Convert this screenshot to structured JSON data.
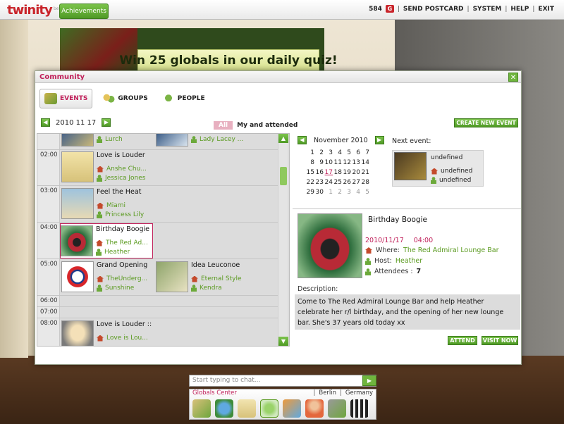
{
  "scene": {
    "banner_text": "Win 25 globals in our daily quiz!"
  },
  "topbar": {
    "logo": "twinity",
    "logo_tag": "beta",
    "achievements": "Achievements",
    "globals": "584",
    "nav": [
      "SEND POSTCARD",
      "SYSTEM",
      "HELP",
      "EXIT"
    ]
  },
  "community": {
    "title": "Community",
    "close": "✕",
    "tabs": [
      {
        "label": "EVENTS",
        "active": true
      },
      {
        "label": "GROUPS",
        "active": false
      },
      {
        "label": "PEOPLE",
        "active": false
      }
    ],
    "date": "2010 11 17",
    "filter_all": "All",
    "filter_mine": "My and attended",
    "create_event": "CREATE NEW EVENT",
    "times": [
      "02:00",
      "03:00",
      "04:00",
      "05:00",
      "06:00",
      "07:00",
      "08:00"
    ],
    "events": [
      {
        "title": "",
        "where": "",
        "host": "Lurch"
      },
      {
        "title": "",
        "where": "",
        "host": "Lady Lacey ..."
      },
      {
        "title": "Love is Louder",
        "where": "Anshe Chu...",
        "host": "Jessica Jones"
      },
      {
        "title": "Feel the Heat",
        "where": "Miami",
        "host": "Princess Lily"
      },
      {
        "title": "Birthday Boogie",
        "where": "The Red Ad...",
        "host": "Heather"
      },
      {
        "title": "Grand Opening",
        "where": "TheUnderg...",
        "host": "Sunshine"
      },
      {
        "title": "Idea Leuconoe",
        "where": "Eternal Style",
        "host": "Kendra"
      },
      {
        "title": "Love is Louder ::",
        "where": "Love is Lou...",
        "host": ""
      }
    ],
    "calendar": {
      "month": "November 2010",
      "next_event_label": "Next event:",
      "weeks": [
        [
          "1",
          "2",
          "3",
          "4",
          "5",
          "6",
          "7"
        ],
        [
          "8",
          "9",
          "10",
          "11",
          "12",
          "13",
          "14"
        ],
        [
          "15",
          "16",
          "17",
          "18",
          "19",
          "20",
          "21"
        ],
        [
          "22",
          "23",
          "24",
          "25",
          "26",
          "27",
          "28"
        ],
        [
          "29",
          "30",
          "1",
          "2",
          "3",
          "4",
          "5"
        ]
      ],
      "today": "17"
    },
    "next_event": {
      "title": "undefined",
      "where": "undefined",
      "host": "undefined"
    },
    "detail": {
      "title": "Birthday Boogie",
      "date": "2010/11/17",
      "time": "04:00",
      "where_label": "Where:",
      "where": "The Red Admiral Lounge Bar",
      "host_label": "Host:",
      "host": "Heather",
      "attendees_label": "Attendees :",
      "attendees": "7",
      "description_label": "Description:",
      "description": "Come to The Red Admiral Lounge Bar and help Heather celebrate her r/l birthday, and the opening of her new lounge bar. She's 37 years old today xx",
      "attend": "ATTEND",
      "visit": "VISIT NOW"
    }
  },
  "chat": {
    "placeholder": "Start typing to chat..."
  },
  "bottombar": {
    "location": "Globals Center",
    "city": "Berlin",
    "country": "Germany"
  },
  "colors": {
    "accent_green": "#5a9a1f",
    "accent_pink": "#c0205a"
  }
}
